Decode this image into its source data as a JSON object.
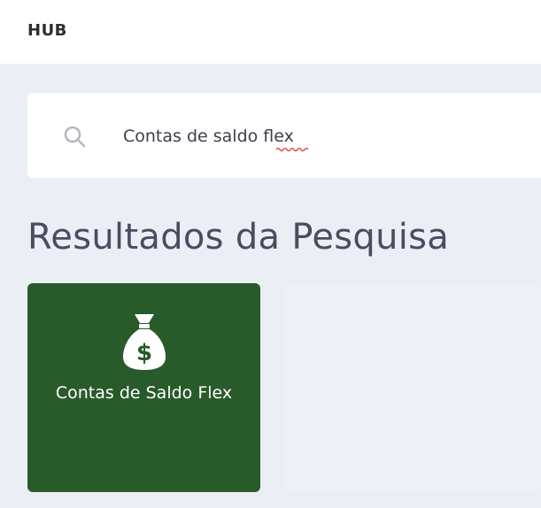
{
  "header": {
    "brand": "HUB"
  },
  "search": {
    "value": "Contas de saldo flex"
  },
  "results": {
    "title": "Resultados da Pesquisa",
    "items": [
      {
        "label": "Contas de Saldo Flex",
        "icon": "money-bag-icon",
        "color": "#285a2a"
      }
    ]
  }
}
